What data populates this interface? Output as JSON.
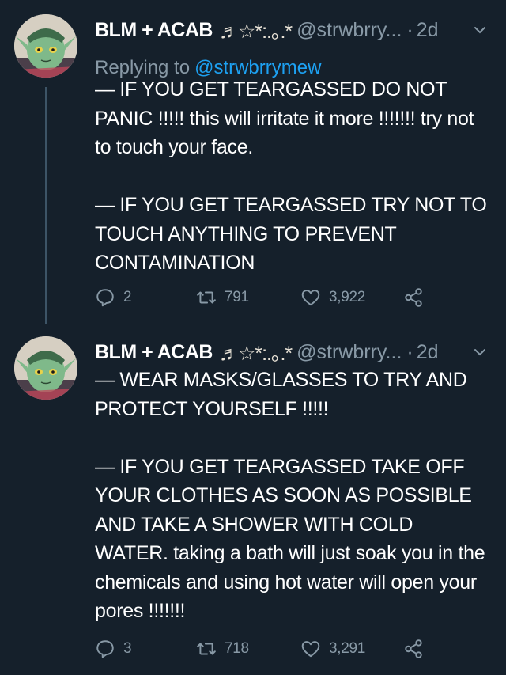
{
  "tweets": [
    {
      "display_name": "BLM + ACAB",
      "name_decoration": "♬☆*:.｡.*",
      "handle": "@strwbrry...",
      "time": "2d",
      "replying_label": "Replying to",
      "replying_to": "@strwbrrymew",
      "text": "— IF YOU GET TEARGASSED DO NOT PANIC !!!!! this will irritate it more !!!!!!! try not to touch your face.\n\n— IF YOU GET TEARGASSED TRY NOT TO TOUCH ANYTHING TO PREVENT CONTAMINATION",
      "replies": "2",
      "retweets": "791",
      "likes": "3,922"
    },
    {
      "display_name": "BLM + ACAB",
      "name_decoration": "♬☆*:.｡.*",
      "handle": "@strwbrry...",
      "time": "2d",
      "text": "— WEAR MASKS/GLASSES TO TRY AND PROTECT YOURSELF !!!!!\n\n— IF YOU GET TEARGASSED TAKE OFF YOUR CLOTHES AS SOON AS POSSIBLE AND TAKE A SHOWER WITH COLD WATER. taking a bath will just soak you in the chemicals and using hot water will open your pores !!!!!!!",
      "replies": "3",
      "retweets": "718",
      "likes": "3,291"
    }
  ],
  "colors": {
    "background": "#15202b",
    "text": "#ffffff",
    "muted": "#8899a6",
    "link": "#1da1f2",
    "thread_line": "#3d5466"
  },
  "icons": [
    "avatar",
    "chevron-down-icon",
    "reply-icon",
    "retweet-icon",
    "like-icon",
    "share-icon"
  ]
}
